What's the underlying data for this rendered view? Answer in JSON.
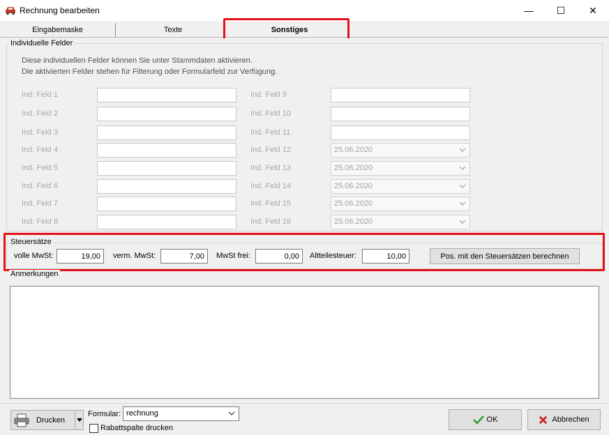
{
  "window": {
    "title": "Rechnung bearbeiten",
    "min_glyph": "—",
    "max_glyph": "☐",
    "close_glyph": "✕"
  },
  "tabs": [
    {
      "label": "Eingabemaske"
    },
    {
      "label": "Texte"
    },
    {
      "label": "Sonstiges",
      "active": true
    }
  ],
  "individual_fields": {
    "group_title": "Individuelle Felder",
    "info_line1": "Diese individuellen Felder können Sie unter Stammdaten aktivieren.",
    "info_line2": "Die aktivierten Felder stehen für Filterung oder Formularfeld zur Verfügung.",
    "left": [
      {
        "label": "Ind. Feld 1",
        "value": ""
      },
      {
        "label": "Ind. Feld 2",
        "value": ""
      },
      {
        "label": "Ind. Feld 3",
        "value": ""
      },
      {
        "label": "Ind. Feld 4",
        "value": ""
      },
      {
        "label": "Ind. Feld 5",
        "value": ""
      },
      {
        "label": "Ind. Feld 6",
        "value": ""
      },
      {
        "label": "Ind. Feld 7",
        "value": ""
      },
      {
        "label": "Ind. Feld 8",
        "value": ""
      }
    ],
    "right": [
      {
        "label": "Ind. Feld 9",
        "value": ""
      },
      {
        "label": "Ind. Feld 10",
        "value": ""
      },
      {
        "label": "Ind. Feld 11",
        "value": ""
      },
      {
        "label": "Ind. Feld 12",
        "value": "25.06.2020"
      },
      {
        "label": "Ind. Feld 13",
        "value": "25.06.2020"
      },
      {
        "label": "Ind. Feld 14",
        "value": "25.06.2020"
      },
      {
        "label": "Ind. Feld 15",
        "value": "25.06.2020"
      },
      {
        "label": "Ind. Feld 16",
        "value": "25.06.2020"
      }
    ]
  },
  "tax": {
    "group_title": "Steuersätze",
    "full_vat_label": "volle MwSt:",
    "full_vat_value": "19,00",
    "reduced_vat_label": "verm. MwSt:",
    "reduced_vat_value": "7,00",
    "vat_free_label": "MwSt frei:",
    "vat_free_value": "0,00",
    "altteil_label": "Altteilesteuer:",
    "altteil_value": "10,00",
    "calc_button": "Pos. mit den Steuersätzen berechnen"
  },
  "remarks": {
    "group_title": "Anmerkungen",
    "value": ""
  },
  "bottom": {
    "print_button": "Drucken",
    "form_label": "Formular:",
    "form_value": "rechnung",
    "discount_checkbox_label": "Rabattspalte drucken",
    "discount_checked": false,
    "ok_button": "OK",
    "cancel_button": "Abbrechen"
  },
  "colors": {
    "highlight": "#e3101a",
    "ok_check": "#2e9e2e",
    "cancel_x": "#d02020"
  },
  "icons": {
    "app": "car-icon",
    "print": "printer-icon",
    "ok": "checkmark-icon",
    "cancel": "x-icon",
    "dropdown": "chevron-down-icon"
  }
}
